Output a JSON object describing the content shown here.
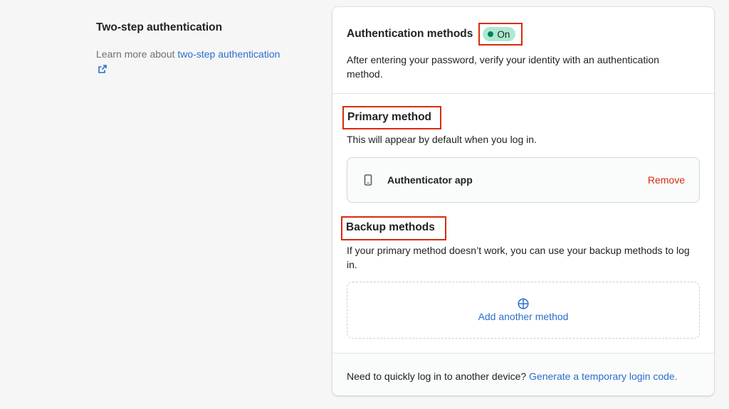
{
  "aside": {
    "title": "Two-step authentication",
    "learn_prefix": "Learn more about ",
    "learn_link": "two-step authentication"
  },
  "auth": {
    "title": "Authentication methods",
    "status": "On",
    "description": "After entering your password, verify your identity with an authentication method."
  },
  "primary": {
    "heading": "Primary method",
    "description": "This will appear by default when you log in.",
    "method_name": "Authenticator app",
    "method_icon": "mobile-phone-icon",
    "remove_label": "Remove"
  },
  "backup": {
    "heading": "Backup methods",
    "description": "If your primary method doesn’t work, you can use your backup methods to log in.",
    "add_label": "Add another method"
  },
  "footer": {
    "prefix": "Need to quickly log in to another device? ",
    "link": "Generate a temporary login code."
  },
  "colors": {
    "link": "#2c6ecb",
    "danger": "#d72c0d",
    "success_badge": "#aee9d1",
    "success_dot": "#007f5f"
  }
}
